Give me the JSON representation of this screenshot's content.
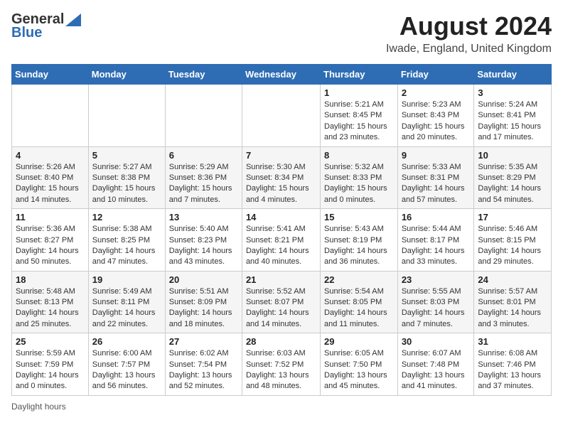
{
  "logo": {
    "general": "General",
    "blue": "Blue"
  },
  "title": "August 2024",
  "location": "Iwade, England, United Kingdom",
  "days_of_week": [
    "Sunday",
    "Monday",
    "Tuesday",
    "Wednesday",
    "Thursday",
    "Friday",
    "Saturday"
  ],
  "footer": "Daylight hours",
  "weeks": [
    [
      {
        "num": "",
        "info": ""
      },
      {
        "num": "",
        "info": ""
      },
      {
        "num": "",
        "info": ""
      },
      {
        "num": "",
        "info": ""
      },
      {
        "num": "1",
        "info": "Sunrise: 5:21 AM\nSunset: 8:45 PM\nDaylight: 15 hours and 23 minutes."
      },
      {
        "num": "2",
        "info": "Sunrise: 5:23 AM\nSunset: 8:43 PM\nDaylight: 15 hours and 20 minutes."
      },
      {
        "num": "3",
        "info": "Sunrise: 5:24 AM\nSunset: 8:41 PM\nDaylight: 15 hours and 17 minutes."
      }
    ],
    [
      {
        "num": "4",
        "info": "Sunrise: 5:26 AM\nSunset: 8:40 PM\nDaylight: 15 hours and 14 minutes."
      },
      {
        "num": "5",
        "info": "Sunrise: 5:27 AM\nSunset: 8:38 PM\nDaylight: 15 hours and 10 minutes."
      },
      {
        "num": "6",
        "info": "Sunrise: 5:29 AM\nSunset: 8:36 PM\nDaylight: 15 hours and 7 minutes."
      },
      {
        "num": "7",
        "info": "Sunrise: 5:30 AM\nSunset: 8:34 PM\nDaylight: 15 hours and 4 minutes."
      },
      {
        "num": "8",
        "info": "Sunrise: 5:32 AM\nSunset: 8:33 PM\nDaylight: 15 hours and 0 minutes."
      },
      {
        "num": "9",
        "info": "Sunrise: 5:33 AM\nSunset: 8:31 PM\nDaylight: 14 hours and 57 minutes."
      },
      {
        "num": "10",
        "info": "Sunrise: 5:35 AM\nSunset: 8:29 PM\nDaylight: 14 hours and 54 minutes."
      }
    ],
    [
      {
        "num": "11",
        "info": "Sunrise: 5:36 AM\nSunset: 8:27 PM\nDaylight: 14 hours and 50 minutes."
      },
      {
        "num": "12",
        "info": "Sunrise: 5:38 AM\nSunset: 8:25 PM\nDaylight: 14 hours and 47 minutes."
      },
      {
        "num": "13",
        "info": "Sunrise: 5:40 AM\nSunset: 8:23 PM\nDaylight: 14 hours and 43 minutes."
      },
      {
        "num": "14",
        "info": "Sunrise: 5:41 AM\nSunset: 8:21 PM\nDaylight: 14 hours and 40 minutes."
      },
      {
        "num": "15",
        "info": "Sunrise: 5:43 AM\nSunset: 8:19 PM\nDaylight: 14 hours and 36 minutes."
      },
      {
        "num": "16",
        "info": "Sunrise: 5:44 AM\nSunset: 8:17 PM\nDaylight: 14 hours and 33 minutes."
      },
      {
        "num": "17",
        "info": "Sunrise: 5:46 AM\nSunset: 8:15 PM\nDaylight: 14 hours and 29 minutes."
      }
    ],
    [
      {
        "num": "18",
        "info": "Sunrise: 5:48 AM\nSunset: 8:13 PM\nDaylight: 14 hours and 25 minutes."
      },
      {
        "num": "19",
        "info": "Sunrise: 5:49 AM\nSunset: 8:11 PM\nDaylight: 14 hours and 22 minutes."
      },
      {
        "num": "20",
        "info": "Sunrise: 5:51 AM\nSunset: 8:09 PM\nDaylight: 14 hours and 18 minutes."
      },
      {
        "num": "21",
        "info": "Sunrise: 5:52 AM\nSunset: 8:07 PM\nDaylight: 14 hours and 14 minutes."
      },
      {
        "num": "22",
        "info": "Sunrise: 5:54 AM\nSunset: 8:05 PM\nDaylight: 14 hours and 11 minutes."
      },
      {
        "num": "23",
        "info": "Sunrise: 5:55 AM\nSunset: 8:03 PM\nDaylight: 14 hours and 7 minutes."
      },
      {
        "num": "24",
        "info": "Sunrise: 5:57 AM\nSunset: 8:01 PM\nDaylight: 14 hours and 3 minutes."
      }
    ],
    [
      {
        "num": "25",
        "info": "Sunrise: 5:59 AM\nSunset: 7:59 PM\nDaylight: 14 hours and 0 minutes."
      },
      {
        "num": "26",
        "info": "Sunrise: 6:00 AM\nSunset: 7:57 PM\nDaylight: 13 hours and 56 minutes."
      },
      {
        "num": "27",
        "info": "Sunrise: 6:02 AM\nSunset: 7:54 PM\nDaylight: 13 hours and 52 minutes."
      },
      {
        "num": "28",
        "info": "Sunrise: 6:03 AM\nSunset: 7:52 PM\nDaylight: 13 hours and 48 minutes."
      },
      {
        "num": "29",
        "info": "Sunrise: 6:05 AM\nSunset: 7:50 PM\nDaylight: 13 hours and 45 minutes."
      },
      {
        "num": "30",
        "info": "Sunrise: 6:07 AM\nSunset: 7:48 PM\nDaylight: 13 hours and 41 minutes."
      },
      {
        "num": "31",
        "info": "Sunrise: 6:08 AM\nSunset: 7:46 PM\nDaylight: 13 hours and 37 minutes."
      }
    ]
  ]
}
